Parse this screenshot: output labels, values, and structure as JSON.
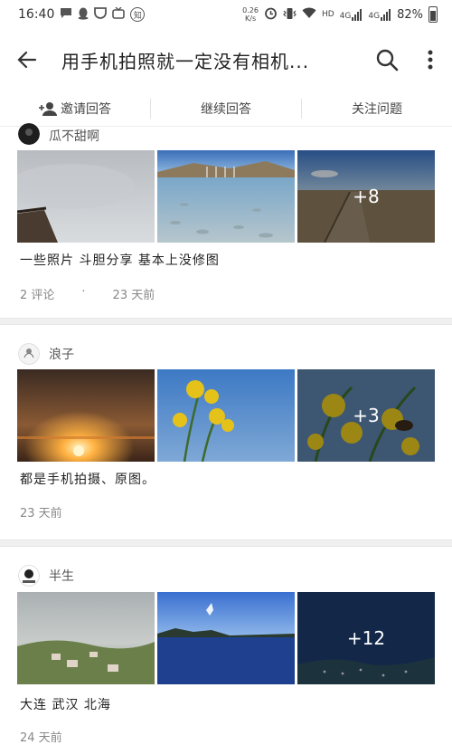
{
  "status": {
    "time": "16:40",
    "net_speed_value": "0.26",
    "net_speed_unit": "K/s",
    "hd": "HD",
    "signal1": "4G",
    "signal2": "4G",
    "battery": "82%",
    "badge": "知"
  },
  "toolbar": {
    "title": "用手机拍照就一定没有相机..."
  },
  "actions": {
    "invite": "邀请回答",
    "continue": "继续回答",
    "follow": "关注问题"
  },
  "answers": [
    {
      "author": "瓜不甜啊",
      "text": "一些照片 斗胆分享 基本上没修图",
      "comments": "2 评论",
      "dot": "·",
      "time": "23 天前",
      "more": "+8"
    },
    {
      "author": "浪子",
      "text": "都是手机拍摄、原图。",
      "time": "23 天前",
      "more": "+3"
    },
    {
      "author": "半生",
      "text": "大连 武汉 北海",
      "time": "24 天前",
      "more": "+12"
    }
  ]
}
